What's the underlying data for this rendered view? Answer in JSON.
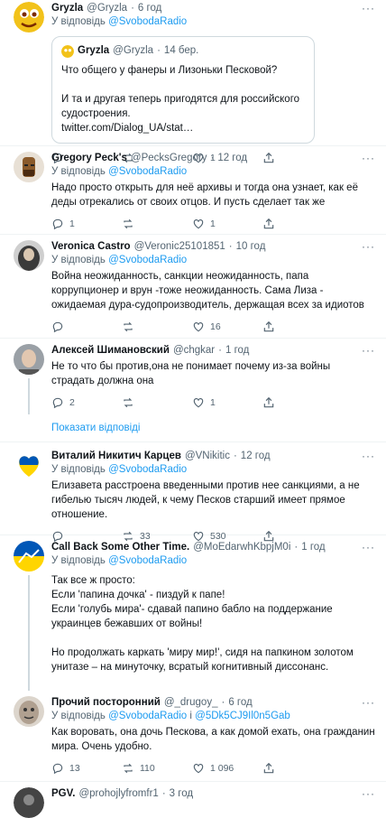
{
  "reply_prefix": "У відповідь",
  "conj_and": "і",
  "more_icon": "···",
  "tweets": [
    {
      "name": "Gryzla",
      "handle": "@Gryzla",
      "time": "6 год",
      "reply_to": "@SvobodaRadio",
      "quote": {
        "name": "Gryzla",
        "handle": "@Gryzla",
        "time": "14 бер.",
        "text": "Что общего у фанеры и Лизоньки Песковой?\n\nИ та и другая теперь пригодятся для российского судостроения.\ntwitter.com/Dialog_UA/stat…"
      },
      "replies": "",
      "retweets": "",
      "likes": "1",
      "avatar_color": "#f2c21a"
    },
    {
      "name": "Gregory Peck's",
      "handle": "@PecksGregory",
      "time": "12 год",
      "reply_to": "@SvobodaRadio",
      "text": "Надо просто открыть для неё архивы и тогда она узнает, как её деды отрекались от своих отцов. И пусть сделает так же",
      "replies": "1",
      "retweets": "",
      "likes": "1",
      "avatar_color": "#8a5a2b"
    },
    {
      "name": "Veronica Castro",
      "handle": "@Veronic25101851",
      "time": "10 год",
      "reply_to": "@SvobodaRadio",
      "text": "Война неожиданность, санкции неожиданность, папа коррупционер и врун -тоже неожиданность. Сама Лиза - ожидаемая дура-судопроизводитель, держащая всех за идиотов",
      "replies": "",
      "retweets": "",
      "likes": "16",
      "avatar_color": "#3a3a3a"
    },
    {
      "name": "Алексей Шимановский",
      "handle": "@chgkar",
      "time": "1 год",
      "reply_to": "@SvobodaRadio",
      "text": "Не то что бы против,она не понимает почему из-за войны страдать должна она",
      "replies": "2",
      "retweets": "",
      "likes": "1",
      "avatar_color": "#6b6b6b",
      "show_replies": "Показати відповіді"
    },
    {
      "name": "Виталий Никитич Карцев",
      "handle": "@VNikitic",
      "time": "12 год",
      "reply_to": "@SvobodaRadio",
      "text": "Елизавета расстроена введенными против нее санкциями, а не гибелью тысяч людей, к чему Песков старший имеет прямое отношение.",
      "replies": "",
      "retweets": "33",
      "likes": "530",
      "avatar_color": "#ffd500"
    },
    {
      "name": "Call Back Some Other Time.",
      "handle": "@MoEdarwhKbpjM0i",
      "time": "1 год",
      "reply_to": "@SvobodaRadio",
      "text": "Так все ж просто:\nЕсли 'папина дочка' - пиздуй к папе!\nЕсли 'голубь мира'- сдавай папино бабло на поддержание украинцев бежавших от войны!\n\nНо продолжать каркать 'миру мир!', сидя на папкином золотом унитазе – на минуточку, всратый когнитивный диссонанс.",
      "replies": "",
      "retweets": "",
      "likes": "",
      "avatar_color": "#0057b7"
    },
    {
      "name": "Прочий посторонний",
      "handle": "@_drugoy_",
      "time": "6 год",
      "reply_to": "@SvobodaRadio",
      "reply_to2": "@5Dk5CJ9Il0n5Gab",
      "text": "Как воровать, она дочь Пескова, а как домой ехать, она гражданин мира. Очень удобно.",
      "replies": "13",
      "retweets": "110",
      "likes": "1 096",
      "avatar_color": "#b0a090"
    },
    {
      "name": "PGV.",
      "handle": "@prohojlyfromfr1",
      "time": "3 год",
      "avatar_color": "#444"
    }
  ]
}
